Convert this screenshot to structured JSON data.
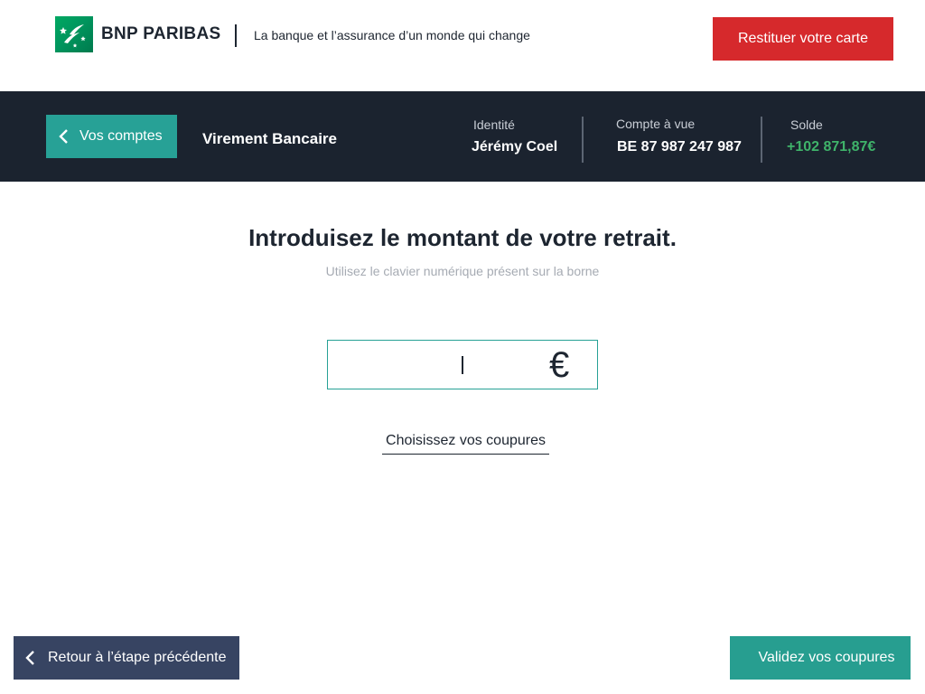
{
  "brand": {
    "name": "BNP PARIBAS",
    "tagline": "La banque et l’assurance d’un monde qui change",
    "logo_icon": "bnp-stars-logo-icon",
    "brand_color": "#00965e"
  },
  "header": {
    "return_card_label": "Restituer votre carte",
    "return_card_color": "#d6292c"
  },
  "account_bar": {
    "back_label": "Vos comptes",
    "back_icon": "chevron-left-icon",
    "page_title": "Virement Bancaire",
    "identity_label": "Identité",
    "identity_value": "Jérémy Coel",
    "account_label": "Compte à vue",
    "account_value": "BE 87 987 247 987",
    "balance_label": "Solde",
    "balance_value": "+102 871,87€",
    "balance_color": "#3fb36a",
    "background": "#1b232f",
    "accent": "#27a196"
  },
  "main": {
    "title": "Introduisez le montant de votre retrait.",
    "subtitle": "Utilisez le clavier numérique présent sur la borne",
    "amount_value": "",
    "currency_symbol": "€",
    "choose_notes_link": "Choisissez vos coupures"
  },
  "footer": {
    "back_label": "Retour à l’étape précédente",
    "back_icon": "chevron-left-icon",
    "back_color": "#374462",
    "validate_label": "Validez vos coupures",
    "validate_color": "#279e90"
  }
}
